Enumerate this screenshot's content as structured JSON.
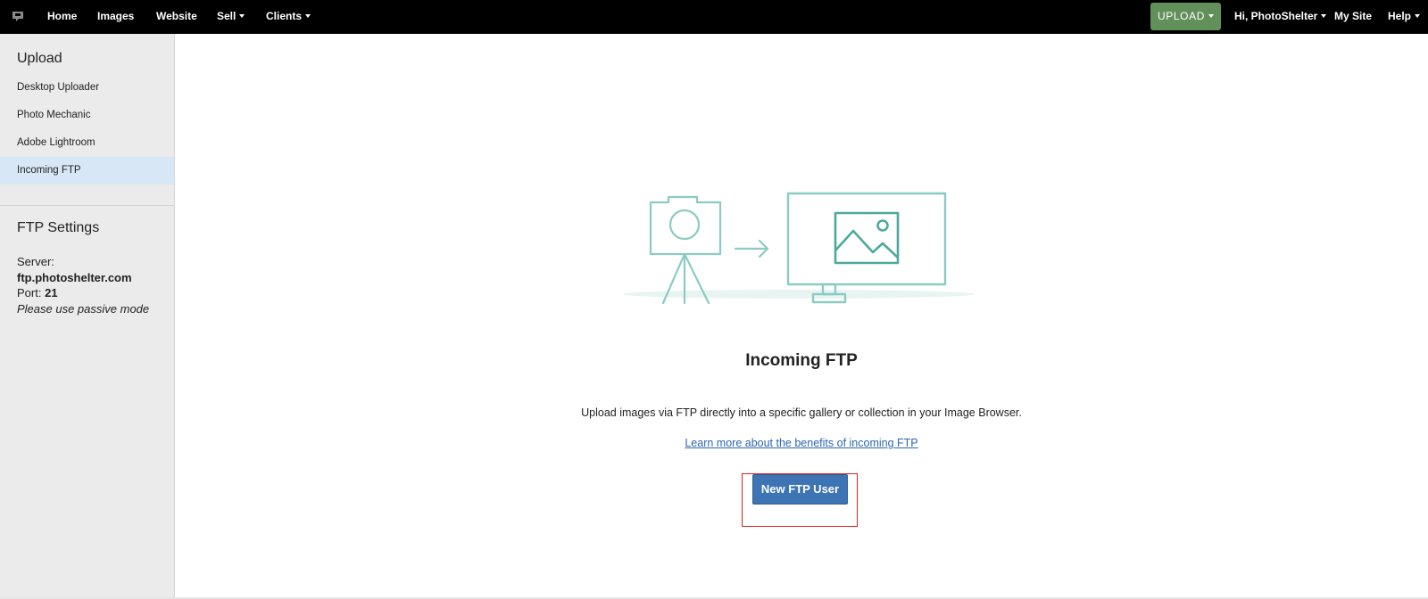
{
  "nav": {
    "logo_icon": "photoshelter-logo-icon",
    "items": [
      {
        "label": "Home"
      },
      {
        "label": "Images"
      },
      {
        "label": "Website"
      },
      {
        "label": "Sell"
      },
      {
        "label": "Clients"
      }
    ],
    "upload_label": "UPLOAD",
    "user_label": "Hi, PhotoShelter",
    "mysite_label": "My Site",
    "help_label": "Help",
    "colors": {
      "bar": "#000000",
      "upload": "#62905a"
    }
  },
  "sidebar": {
    "upload_heading": "Upload",
    "links": [
      {
        "label": "Desktop Uploader"
      },
      {
        "label": "Photo Mechanic"
      },
      {
        "label": "Adobe Lightroom"
      },
      {
        "label": "Incoming FTP",
        "active": true
      }
    ],
    "ftp_heading": "FTP Settings",
    "server_label": "Server:",
    "server_value": "ftp.photoshelter.com",
    "port_label": "Port:",
    "port_value": "21",
    "mode_note": "Please use passive mode"
  },
  "main": {
    "illustration_icon": "camera-to-monitor-illustration",
    "title": "Incoming FTP",
    "description": "Upload images via FTP directly into a specific gallery or collection in your Image Browser.",
    "learn_more": "Learn more about the benefits of incoming FTP",
    "new_user_button": "New FTP User",
    "colors": {
      "primary": "#3d74b3",
      "illustration": "#8ccbc2",
      "link": "#2e66b0",
      "highlight": "#e0201c"
    }
  }
}
